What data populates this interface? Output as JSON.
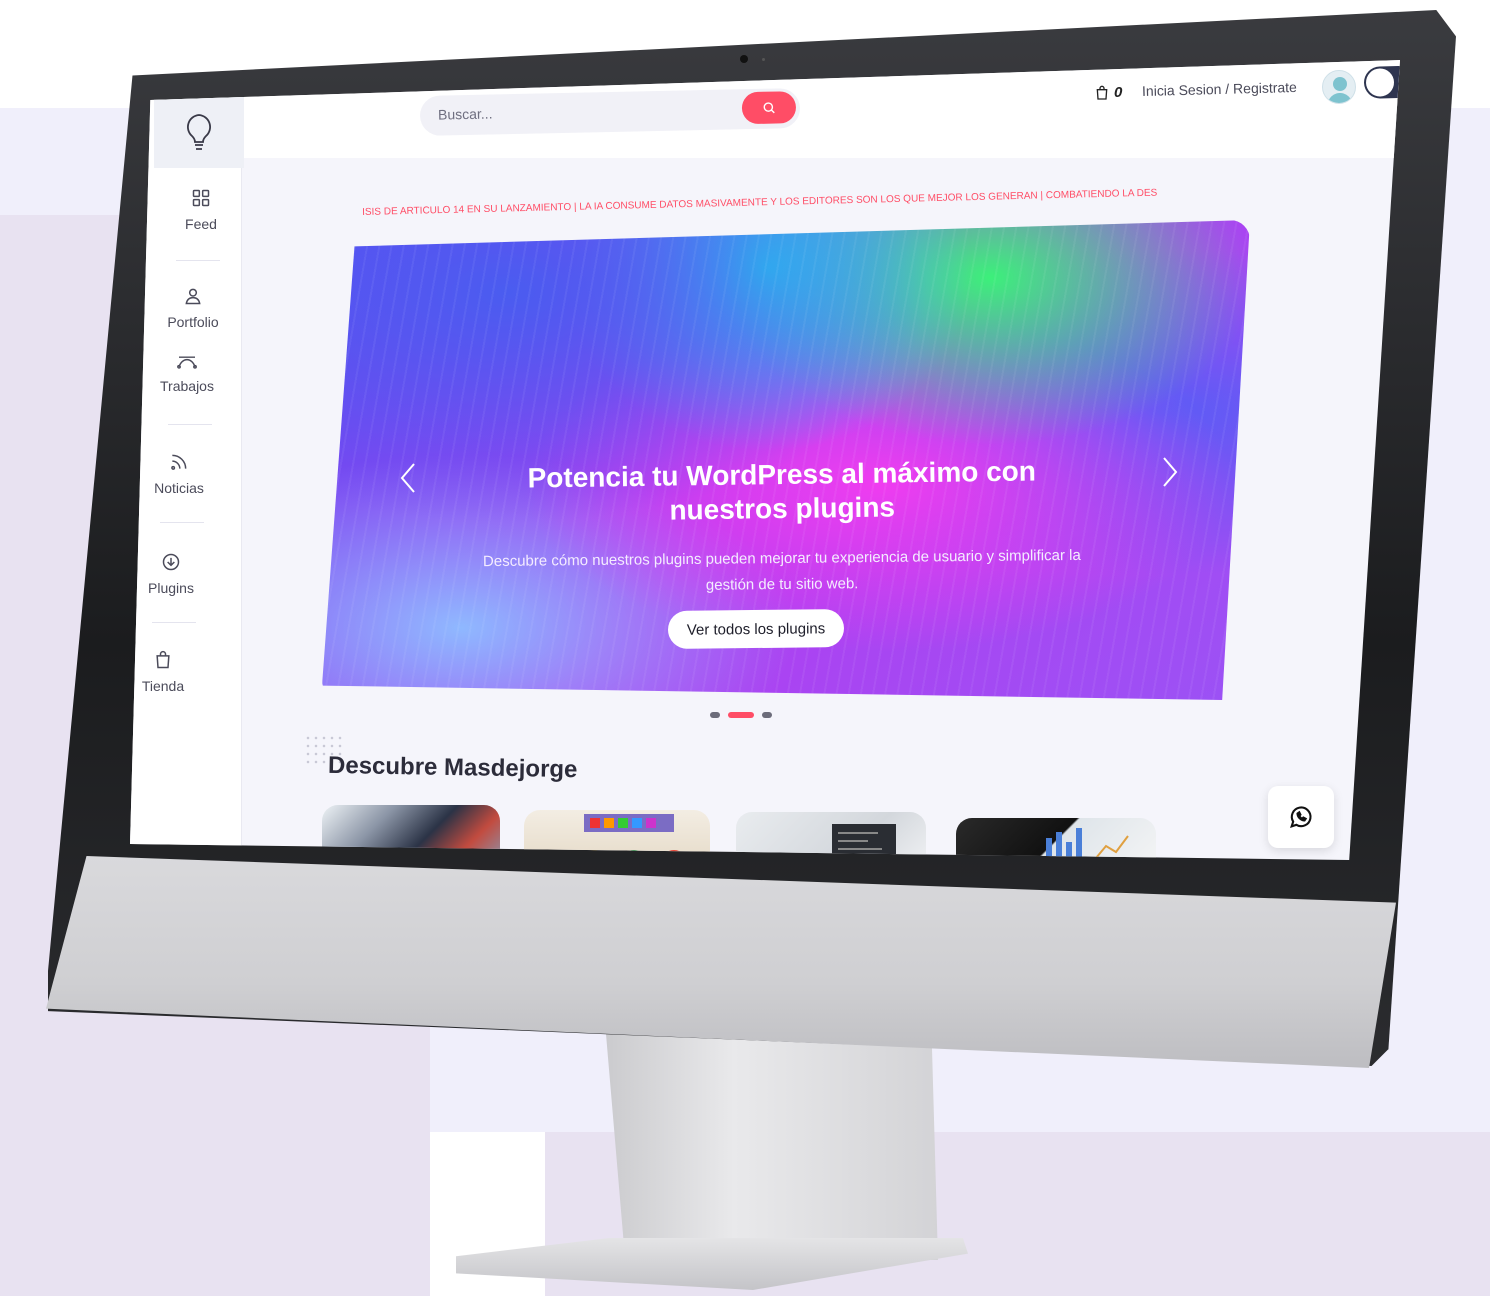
{
  "search": {
    "placeholder": "Buscar..."
  },
  "header": {
    "cart_count": "0",
    "login_label": "Inicia Sesion / Registrate"
  },
  "sidebar": {
    "items": [
      {
        "label": "Feed",
        "icon": "grid-icon"
      },
      {
        "label": "Portfolio",
        "icon": "user-icon"
      },
      {
        "label": "Trabajos",
        "icon": "pen-tool-icon"
      },
      {
        "label": "Noticias",
        "icon": "rss-icon"
      },
      {
        "label": "Plugins",
        "icon": "download-icon"
      },
      {
        "label": "Tienda",
        "icon": "shopping-bag-icon"
      }
    ]
  },
  "ticker": {
    "text": "ISIS DE ARTICULO 14 EN SU LANZAMIENTO | LA IA CONSUME DATOS MASIVAMENTE Y LOS EDITORES SON LOS QUE MEJOR LOS GENERAN | COMBATIENDO LA DES"
  },
  "hero": {
    "title": "Potencia tu WordPress al máximo con nuestros plugins",
    "subtitle": "Descubre cómo nuestros plugins pueden mejorar tu experiencia de usuario y simplificar la gestión de tu sitio web.",
    "button_label": "Ver todos los plugins",
    "active_slide": 2,
    "slide_count": 3
  },
  "discover": {
    "title": "Descubre Masdejorge"
  },
  "colors": {
    "accent": "#ff4d66",
    "toggle": "#2e3550"
  }
}
